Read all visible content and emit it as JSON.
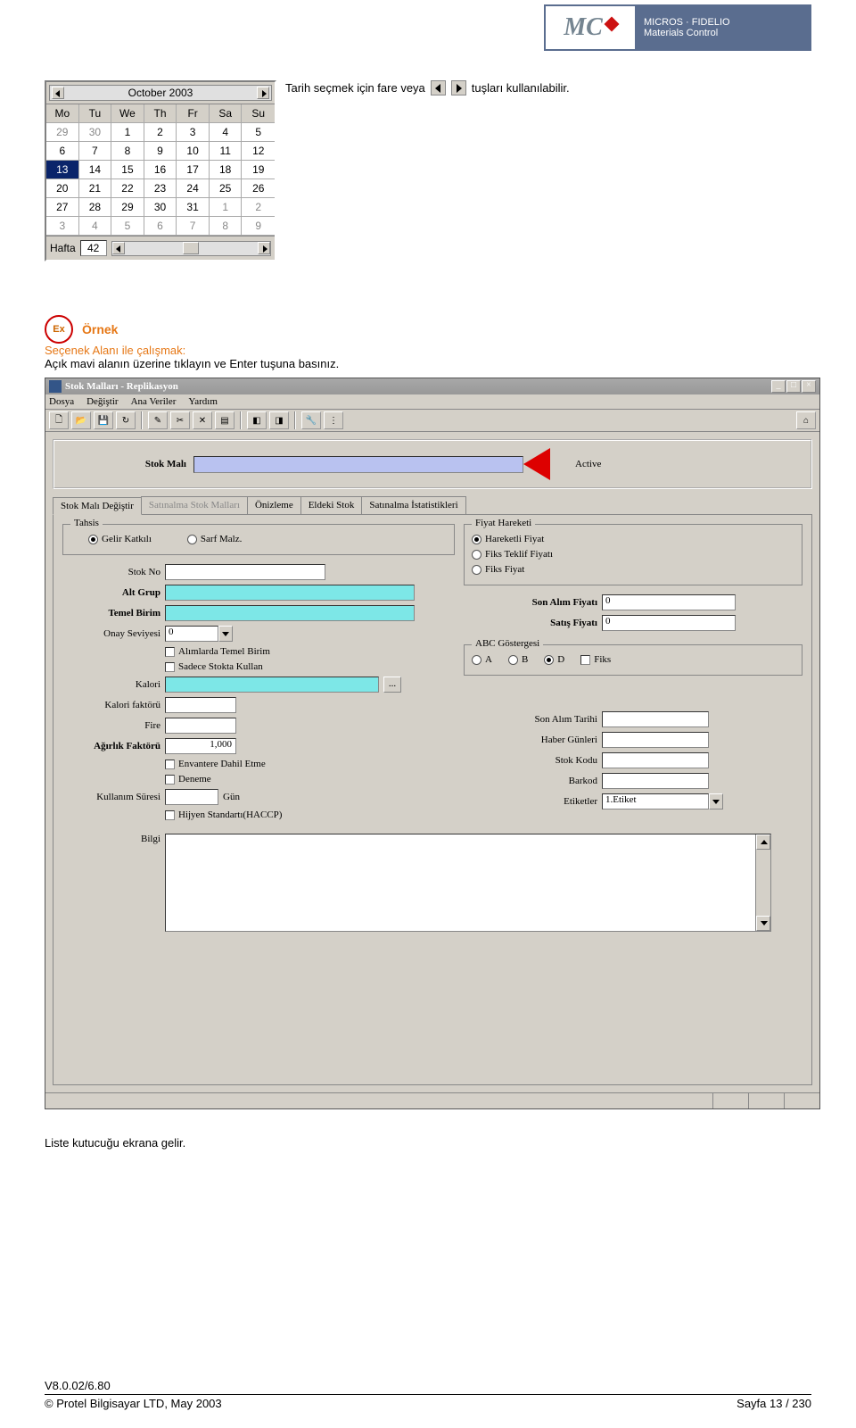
{
  "logo": {
    "mc": "MC",
    "tagline1": "MICROS · FIDELIO",
    "tagline2": "Materials Control"
  },
  "intro": {
    "pre": "Tarih seçmek için fare veya",
    "post": "tuşları kullanılabilir."
  },
  "calendar": {
    "month": "October 2003",
    "days": [
      "Mo",
      "Tu",
      "We",
      "Th",
      "Fr",
      "Sa",
      "Su"
    ],
    "rows": [
      [
        "29",
        "30",
        "1",
        "2",
        "3",
        "4",
        "5"
      ],
      [
        "6",
        "7",
        "8",
        "9",
        "10",
        "11",
        "12"
      ],
      [
        "13",
        "14",
        "15",
        "16",
        "17",
        "18",
        "19"
      ],
      [
        "20",
        "21",
        "22",
        "23",
        "24",
        "25",
        "26"
      ],
      [
        "27",
        "28",
        "29",
        "30",
        "31",
        "1",
        "2"
      ],
      [
        "3",
        "4",
        "5",
        "6",
        "7",
        "8",
        "9"
      ]
    ],
    "gray_head": [
      "29",
      "30"
    ],
    "gray_tail_start_row": 4,
    "week_label": "Hafta",
    "week_value": "42",
    "selected": "13"
  },
  "example": {
    "ornek": "Örnek",
    "secenek": "Seçenek Alanı ile çalışmak:",
    "body": "Açık mavi alanın üzerine tıklayın ve Enter tuşuna basınız."
  },
  "app": {
    "title": "Stok Malları - Replikasyon",
    "menu": [
      "Dosya",
      "Değiştir",
      "Ana Veriler",
      "Yardım"
    ],
    "top_label": "Stok Malı",
    "active": "Active",
    "tabs": [
      "Stok Malı Değiştir",
      "Satınalma Stok Malları",
      "Önizleme",
      "Eldeki Stok",
      "Satınalma İstatistikleri"
    ],
    "tahsis": {
      "title": "Tahsis",
      "o1": "Gelir Katkılı",
      "o2": "Sarf Malz."
    },
    "fiyat": {
      "title": "Fiyat Hareketi",
      "o1": "Hareketli Fiyat",
      "o2": "Fiks Teklif Fiyatı",
      "o3": "Fiks Fiyat"
    },
    "labels": {
      "stokno": "Stok No",
      "altgrup": "Alt Grup",
      "temelbirim": "Temel Birim",
      "onay": "Onay Seviyesi",
      "onay_val": "0",
      "alim_temel": "Alımlarda Temel Birim",
      "sadece_stok": "Sadece Stokta Kullan",
      "kalori": "Kalori",
      "kalori_faktoru": "Kalori faktörü",
      "fire": "Fire",
      "agirlik": "Ağırlık Faktörü",
      "agirlik_val": "1,000",
      "envanter": "Envantere Dahil Etme",
      "deneme": "Deneme",
      "kullanim": "Kullanım Süresi",
      "gun": "Gün",
      "haccp": "Hijyen Standartı(HACCP)",
      "bilgi": "Bilgi",
      "son_alim": "Son Alım Fiyatı",
      "son_alim_val": "0",
      "satis": "Satış Fiyatı",
      "satis_val": "0",
      "abc": "ABC Göstergesi",
      "a": "A",
      "b": "B",
      "d": "D",
      "fiks": "Fiks",
      "son_tarih": "Son Alım Tarihi",
      "haber": "Haber Günleri",
      "stok_kodu": "Stok Kodu",
      "barkod": "Barkod",
      "etiketler": "Etiketler",
      "etiket_val": "1.Etiket"
    }
  },
  "post": "Liste kutucuğu ekrana gelir.",
  "footer": {
    "version": "V8.0.02/6.80",
    "company": "© Protel Bilgisayar LTD, May 2003",
    "page": "Sayfa 13 / 230"
  }
}
